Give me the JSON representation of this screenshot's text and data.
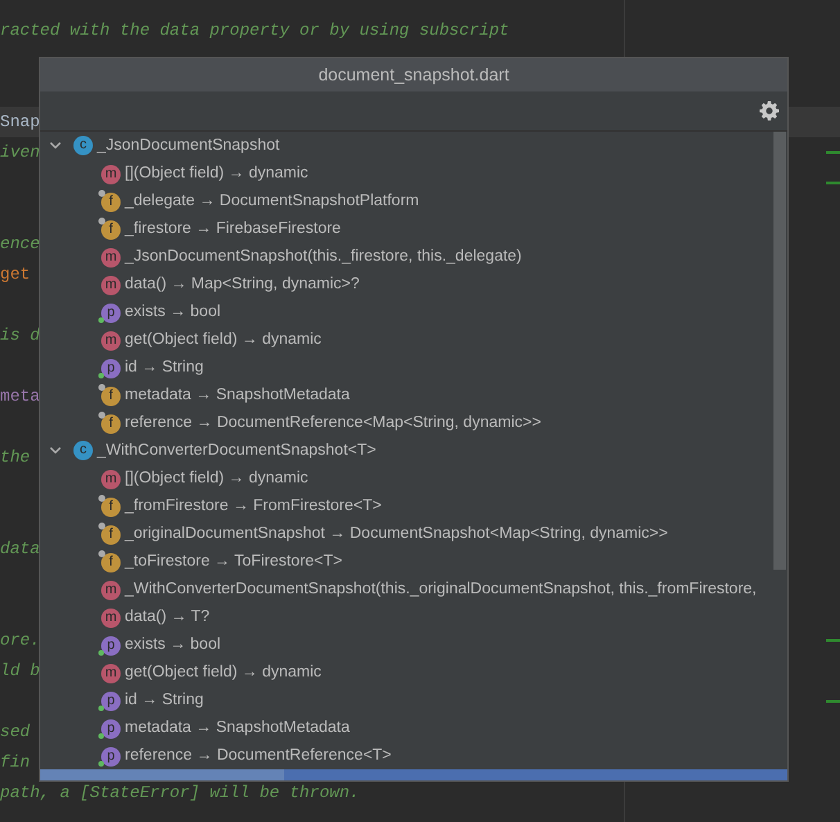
{
  "editor": {
    "lines": [
      {
        "text": "racted with the data property or by using subscript",
        "kind": "comment",
        "current": false,
        "marked": false
      },
      {
        "current": false,
        "marked": false
      },
      {
        "current": false,
        "marked": false
      },
      {
        "text": "Snap",
        "kind": "plain",
        "current": true,
        "marked": false
      },
      {
        "text": "iven",
        "kind": "comment",
        "current": false,
        "marked": true
      },
      {
        "current": false,
        "marked": true
      },
      {
        "current": false,
        "marked": false
      },
      {
        "text": "ence",
        "kind": "comment",
        "current": false,
        "marked": false
      },
      {
        "text": "get",
        "kind": "keyword",
        "current": false,
        "marked": false
      },
      {
        "current": false,
        "marked": false
      },
      {
        "text": "is d",
        "kind": "comment",
        "current": false,
        "marked": false
      },
      {
        "current": false,
        "marked": false
      },
      {
        "text": "meta",
        "kind": "field",
        "current": false,
        "marked": false
      },
      {
        "current": false,
        "marked": false
      },
      {
        "text": "the",
        "kind": "comment",
        "current": false,
        "marked": false
      },
      {
        "current": false,
        "marked": false
      },
      {
        "current": false,
        "marked": false
      },
      {
        "text": "data",
        "kind": "comment",
        "current": false,
        "marked": false
      },
      {
        "current": false,
        "marked": false
      },
      {
        "current": false,
        "marked": false
      },
      {
        "text": "ore.",
        "kind": "comment",
        "current": false,
        "marked": true
      },
      {
        "text": "ld b",
        "kind": "comment",
        "current": false,
        "marked": false
      },
      {
        "current": false,
        "marked": true
      },
      {
        "text": "sed",
        "kind": "comment",
        "current": false,
        "marked": false
      },
      {
        "text": "fin",
        "kind": "comment",
        "current": false,
        "marked": false
      },
      {
        "text": "path, a [StateError] will be thrown.",
        "kind": "comment",
        "current": false,
        "marked": false
      }
    ]
  },
  "popup": {
    "title": "document_snapshot.dart",
    "tree": [
      {
        "label": "_JsonDocumentSnapshot",
        "icon": "c",
        "kind": "class",
        "expanded": true,
        "children": [
          {
            "label": "[](Object field) → dynamic",
            "icon": "m",
            "kind": "method",
            "lock_badge": false,
            "dot_badge": false
          },
          {
            "label": "_delegate → DocumentSnapshotPlatform",
            "icon": "f",
            "kind": "field",
            "lock_badge": true,
            "dot_badge": false
          },
          {
            "label": "_firestore → FirebaseFirestore",
            "icon": "f",
            "kind": "field",
            "lock_badge": true,
            "dot_badge": false
          },
          {
            "label": "_JsonDocumentSnapshot(this._firestore, this._delegate)",
            "icon": "m",
            "kind": "method",
            "lock_badge": false,
            "dot_badge": false
          },
          {
            "label": "data() → Map<String, dynamic>?",
            "icon": "m",
            "kind": "method",
            "lock_badge": false,
            "dot_badge": false
          },
          {
            "label": "exists → bool",
            "icon": "p",
            "kind": "property",
            "lock_badge": false,
            "dot_badge": true
          },
          {
            "label": "get(Object field) → dynamic",
            "icon": "m",
            "kind": "method",
            "lock_badge": false,
            "dot_badge": false
          },
          {
            "label": "id → String",
            "icon": "p",
            "kind": "property",
            "lock_badge": false,
            "dot_badge": true
          },
          {
            "label": "metadata → SnapshotMetadata",
            "icon": "f",
            "kind": "field",
            "lock_badge": true,
            "dot_badge": false
          },
          {
            "label": "reference → DocumentReference<Map<String, dynamic>>",
            "icon": "f",
            "kind": "field",
            "lock_badge": true,
            "dot_badge": false
          }
        ]
      },
      {
        "label": "_WithConverterDocumentSnapshot<T>",
        "icon": "c",
        "kind": "class",
        "expanded": true,
        "children": [
          {
            "label": "[](Object field) → dynamic",
            "icon": "m",
            "kind": "method",
            "lock_badge": false,
            "dot_badge": false
          },
          {
            "label": "_fromFirestore → FromFirestore<T>",
            "icon": "f",
            "kind": "field",
            "lock_badge": true,
            "dot_badge": false
          },
          {
            "label": "_originalDocumentSnapshot → DocumentSnapshot<Map<String, dynamic>>",
            "icon": "f",
            "kind": "field",
            "lock_badge": true,
            "dot_badge": false
          },
          {
            "label": "_toFirestore → ToFirestore<T>",
            "icon": "f",
            "kind": "field",
            "lock_badge": true,
            "dot_badge": false
          },
          {
            "label": "_WithConverterDocumentSnapshot(this._originalDocumentSnapshot, this._fromFirestore,",
            "icon": "m",
            "kind": "method",
            "lock_badge": false,
            "dot_badge": false
          },
          {
            "label": "data() → T?",
            "icon": "m",
            "kind": "method",
            "lock_badge": false,
            "dot_badge": false
          },
          {
            "label": "exists → bool",
            "icon": "p",
            "kind": "property",
            "lock_badge": false,
            "dot_badge": true
          },
          {
            "label": "get(Object field) → dynamic",
            "icon": "m",
            "kind": "method",
            "lock_badge": false,
            "dot_badge": false
          },
          {
            "label": "id → String",
            "icon": "p",
            "kind": "property",
            "lock_badge": false,
            "dot_badge": true
          },
          {
            "label": "metadata → SnapshotMetadata",
            "icon": "p",
            "kind": "property",
            "lock_badge": false,
            "dot_badge": true
          },
          {
            "label": "reference → DocumentReference<T>",
            "icon": "p",
            "kind": "property",
            "lock_badge": false,
            "dot_badge": true
          }
        ]
      }
    ]
  }
}
